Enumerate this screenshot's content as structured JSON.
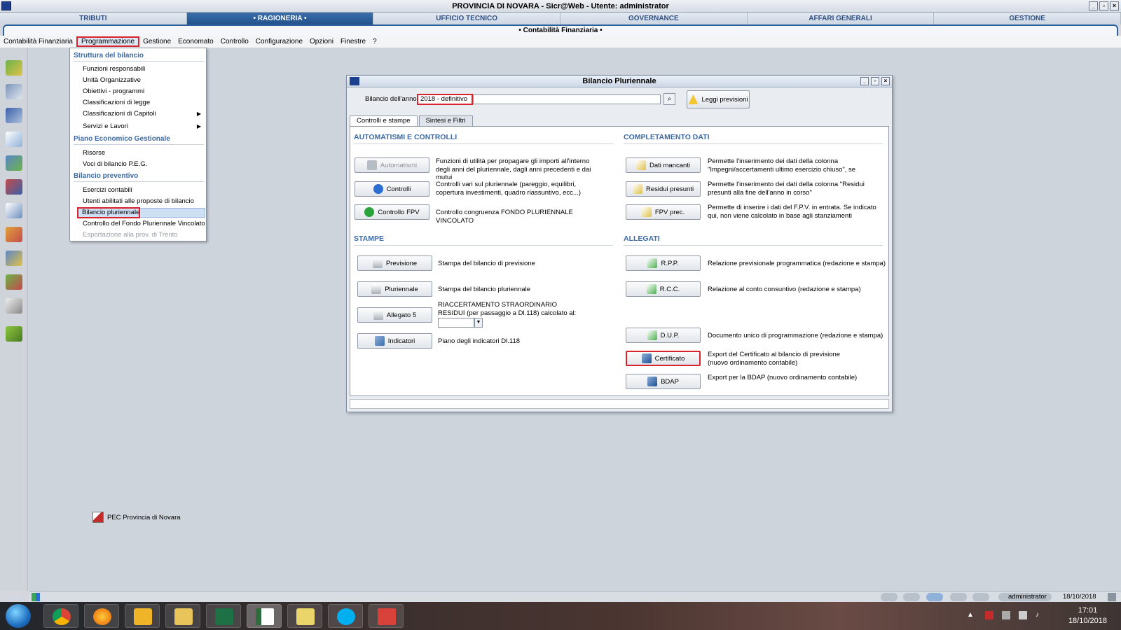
{
  "window": {
    "title": "PROVINCIA DI NOVARA - Sicr@Web - Utente: administrator"
  },
  "modules": [
    "TRIBUTI",
    "• RAGIONERIA •",
    "UFFICIO TECNICO",
    "GOVERNANCE",
    "AFFARI GENERALI",
    "GESTIONE"
  ],
  "subtitle": "• Contabilità Finanziaria •",
  "menu": [
    "Contabilità Finanziaria",
    "Programmazione",
    "Gestione",
    "Economato",
    "Controllo",
    "Configurazione",
    "Opzioni",
    "Finestre",
    "?"
  ],
  "dropdown": {
    "sections": [
      "Struttura del bilancio",
      "Piano Economico Gestionale",
      "Bilancio preventivo"
    ],
    "items": [
      "Funzioni responsabili",
      "Unità Organizzative",
      "Obiettivi - programmi",
      "Classificazioni di legge",
      "Classificazioni di Capitoli",
      "Servizi e Lavori",
      "Risorse",
      "Voci di bilancio P.E.G.",
      "Esercizi contabili",
      "Utenti abilitati alle proposte di bilancio",
      "Bilancio pluriennale",
      "Controllo del Fondo Pluriennale Vincolato",
      "Esportazione alla prov. di Trento"
    ]
  },
  "desktop": {
    "pec_label": "PEC Provincia di Novara"
  },
  "dialog": {
    "title": "Bilancio Pluriennale",
    "year_label": "Bilancio dell'anno:",
    "year_value": "2018 - definitivo",
    "read_button": "Leggi previsioni",
    "tabs": [
      "Controlli e stampe",
      "Sintesi e Filtri"
    ],
    "sections": {
      "auto": "AUTOMATISMI E CONTROLLI",
      "complete": "COMPLETAMENTO DATI",
      "print": "STAMPE",
      "attach": "ALLEGATI"
    },
    "auto": [
      {
        "label": "Automatismi",
        "desc": "Funzioni di utilità per propagare gli importi all'interno degli anni del pluriennale, dagli anni precedenti e dai mutui"
      },
      {
        "label": "Controlli",
        "desc": "Controlli vari sul pluriennale (pareggio, equilibri, copertura investimenti, quadro riassuntivo, ecc...)"
      },
      {
        "label": "Controllo FPV",
        "desc": "Controllo congruenza FONDO PLURIENNALE VINCOLATO"
      }
    ],
    "complete": [
      {
        "label": "Dati mancanti",
        "desc": "Permette l'inserimento dei dati della colonna \"Impegni/accertamenti ultimo esercizio chiuso\", se"
      },
      {
        "label": "Residui presunti",
        "desc": "Permette l'inserimento dei dati della colonna \"Residui presunti alla fine dell'anno in corso\""
      },
      {
        "label": "FPV prec.",
        "desc": "Permette di inserire i dati del F.P.V. in entrata. Se indicato qui, non viene calcolato in base agli stanziamenti"
      }
    ],
    "print": [
      {
        "label": "Previsione",
        "desc": "Stampa del bilancio di previsione"
      },
      {
        "label": "Pluriennale",
        "desc": "Stampa del bilancio pluriennale"
      },
      {
        "label": "Allegato 5",
        "desc": "RIACCERTAMENTO STRAORDINARIO RESIDUI (per passaggio a Dl.118) calcolato al:"
      },
      {
        "label": "Indicatori",
        "desc": "Piano degli indicatori Dl.118"
      }
    ],
    "attach": [
      {
        "label": "R.P.P.",
        "desc": "Relazione previsionale programmatica (redazione e stampa)"
      },
      {
        "label": "R.C.C.",
        "desc": "Relazione al conto consuntivo (redazione e stampa)"
      },
      {
        "label": "D.U.P.",
        "desc": "Documento unico di programmazione (redazione e stampa)"
      },
      {
        "label": "Certificato",
        "desc": "Export del Certificato al bilancio di previsione (nuovo ordinamento contabile)"
      },
      {
        "label": "BDAP",
        "desc": "Export per la BDAP (nuovo ordinamento contabile)"
      }
    ]
  },
  "statusbar": {
    "user": "administrator",
    "date": "18/10/2018"
  },
  "taskbar": {
    "time": "17:01",
    "date": "18/10/2018"
  },
  "colors": {
    "accent": "#2d5f9a",
    "highlight_border": "#d9232d",
    "section_text": "#3d6aa4"
  }
}
